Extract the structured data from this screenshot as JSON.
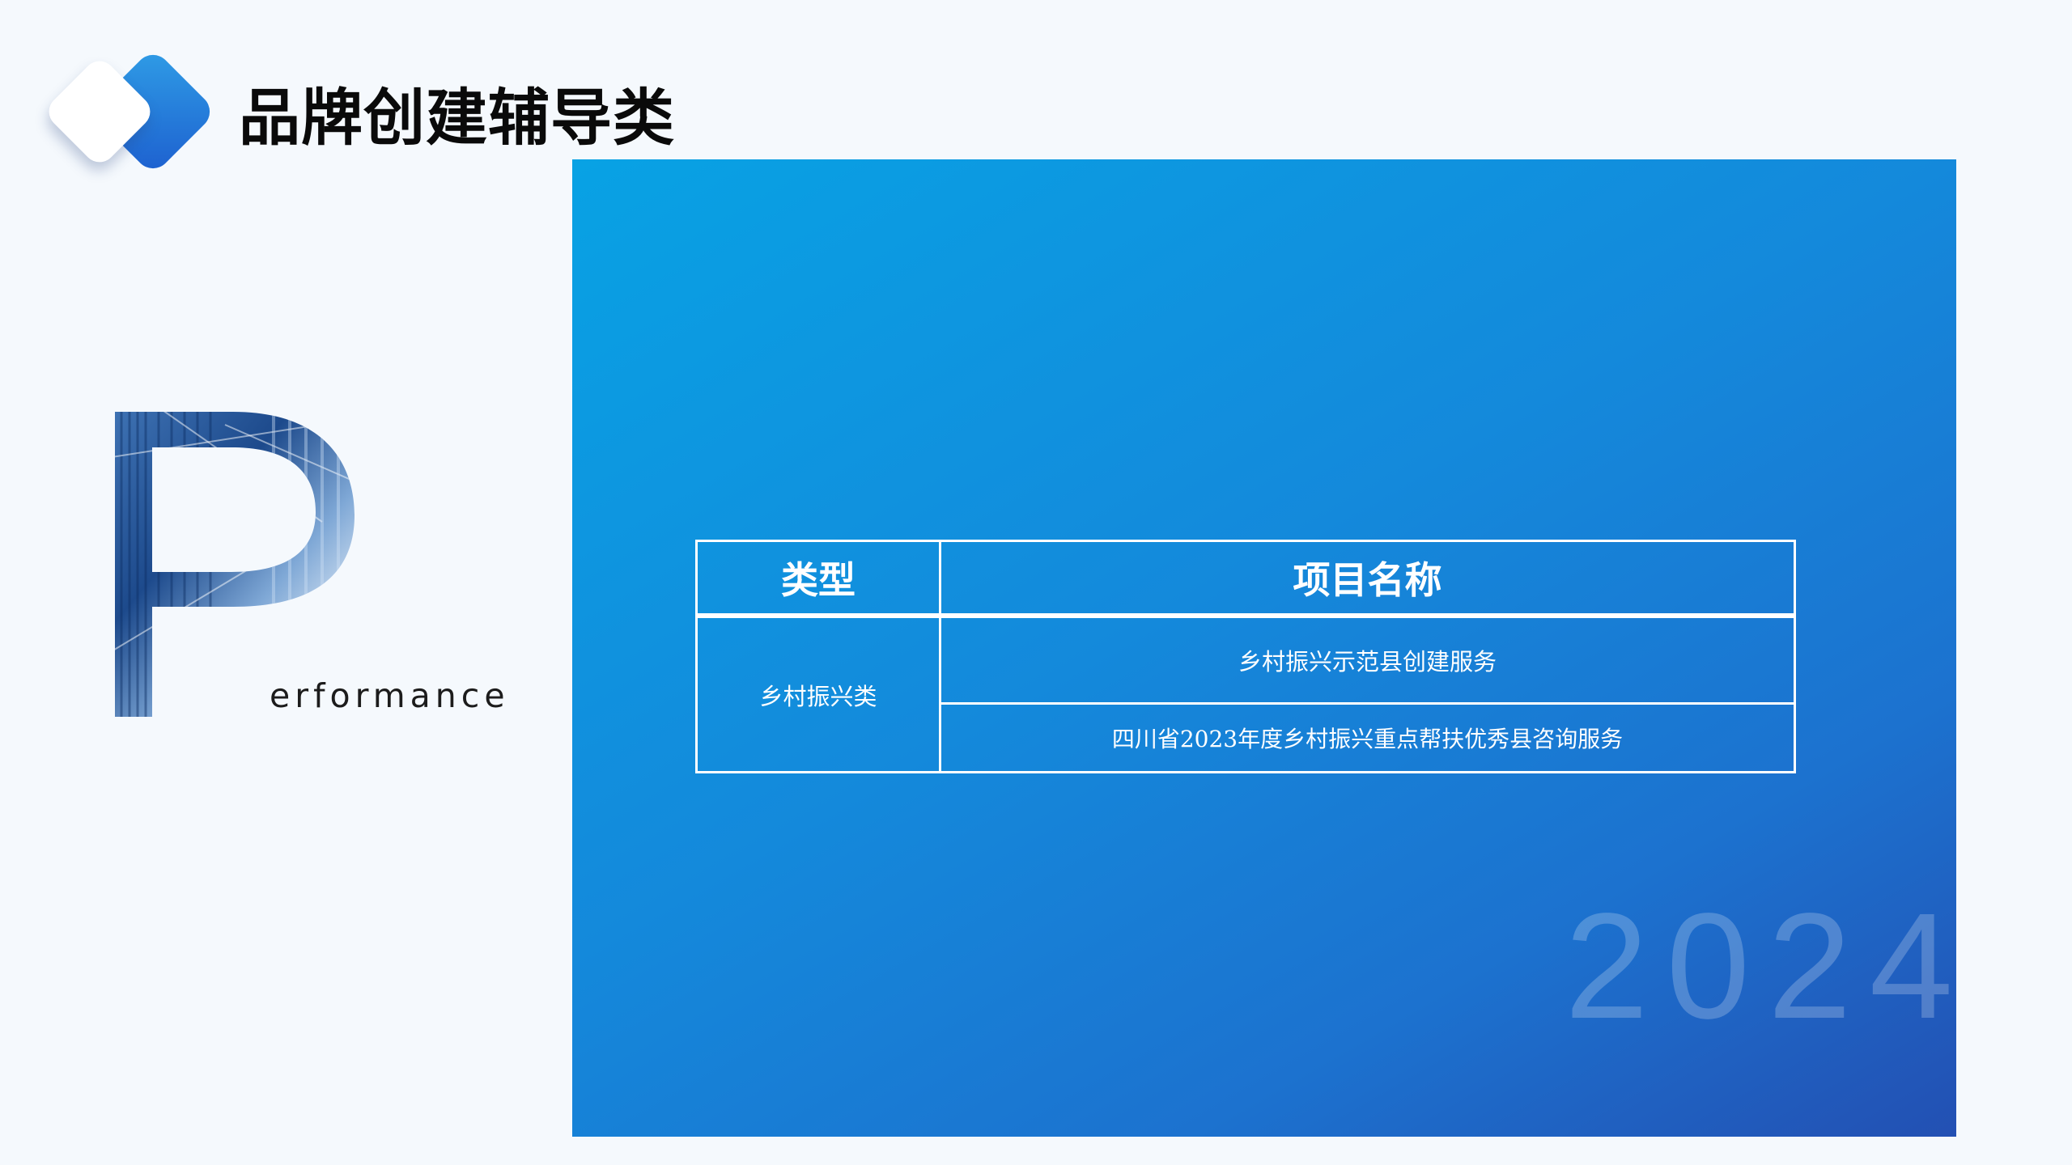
{
  "header": {
    "title": "品牌创建辅导类",
    "logo_icon": "rounded-diamond-logo-icon"
  },
  "decoration": {
    "big_letter": "P",
    "word_rest": "erformance"
  },
  "panel": {
    "year": "2024",
    "gradient_colors": [
      "#08a2e4",
      "#1c72cf",
      "#2350b3"
    ]
  },
  "table": {
    "headers": {
      "type": "类型",
      "project_name": "项目名称"
    },
    "category": "乡村振兴类",
    "projects": [
      "乡村振兴示范县创建服务",
      "四川省2023年度乡村振兴重点帮扶优秀县咨询服务"
    ]
  }
}
